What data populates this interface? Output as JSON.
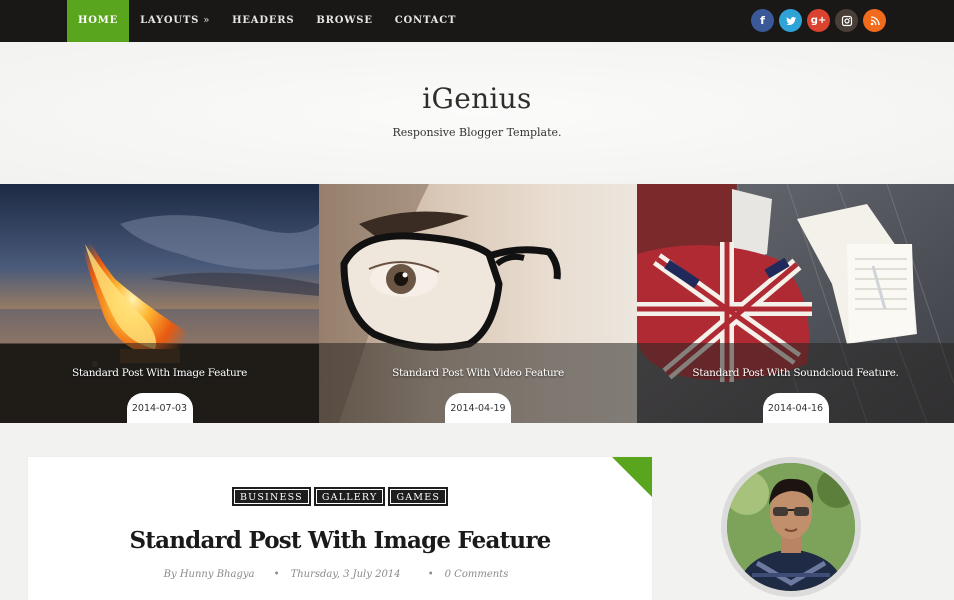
{
  "nav": {
    "items": [
      {
        "label": "HOME",
        "active": true
      },
      {
        "label": "LAYOUTS",
        "submenu": "»"
      },
      {
        "label": "HEADERS"
      },
      {
        "label": "BROWSE"
      },
      {
        "label": "CONTACT"
      }
    ],
    "social": [
      {
        "icon": "facebook-icon",
        "glyph": "f",
        "color": "#3b5998"
      },
      {
        "icon": "twitter-icon",
        "glyph": "t",
        "color": "#2fa3d8"
      },
      {
        "icon": "google-plus-icon",
        "glyph": "g+",
        "color": "#d9432f"
      },
      {
        "icon": "instagram-icon",
        "glyph": "",
        "color": "#4a3f38"
      },
      {
        "icon": "rss-icon",
        "glyph": "",
        "color": "#f26a1b"
      }
    ]
  },
  "header": {
    "title": "iGenius",
    "description": "Responsive Blogger Template."
  },
  "slider": [
    {
      "title": "Standard Post With Image Feature",
      "date": "2014-07-03"
    },
    {
      "title": "Standard Post With Video Feature",
      "date": "2014-04-19"
    },
    {
      "title": "Standard Post With Soundcloud Feature.",
      "date": "2014-04-16"
    }
  ],
  "post": {
    "tags": [
      "BUSINESS",
      "GALLERY",
      "GAMES"
    ],
    "title": "Standard Post With Image Feature",
    "author": "By Hunny Bhagya",
    "date": "Thursday, 3 July 2014",
    "comments": "0 Comments"
  },
  "colors": {
    "accent": "#5aa51e",
    "topbar": "#1a1816"
  }
}
